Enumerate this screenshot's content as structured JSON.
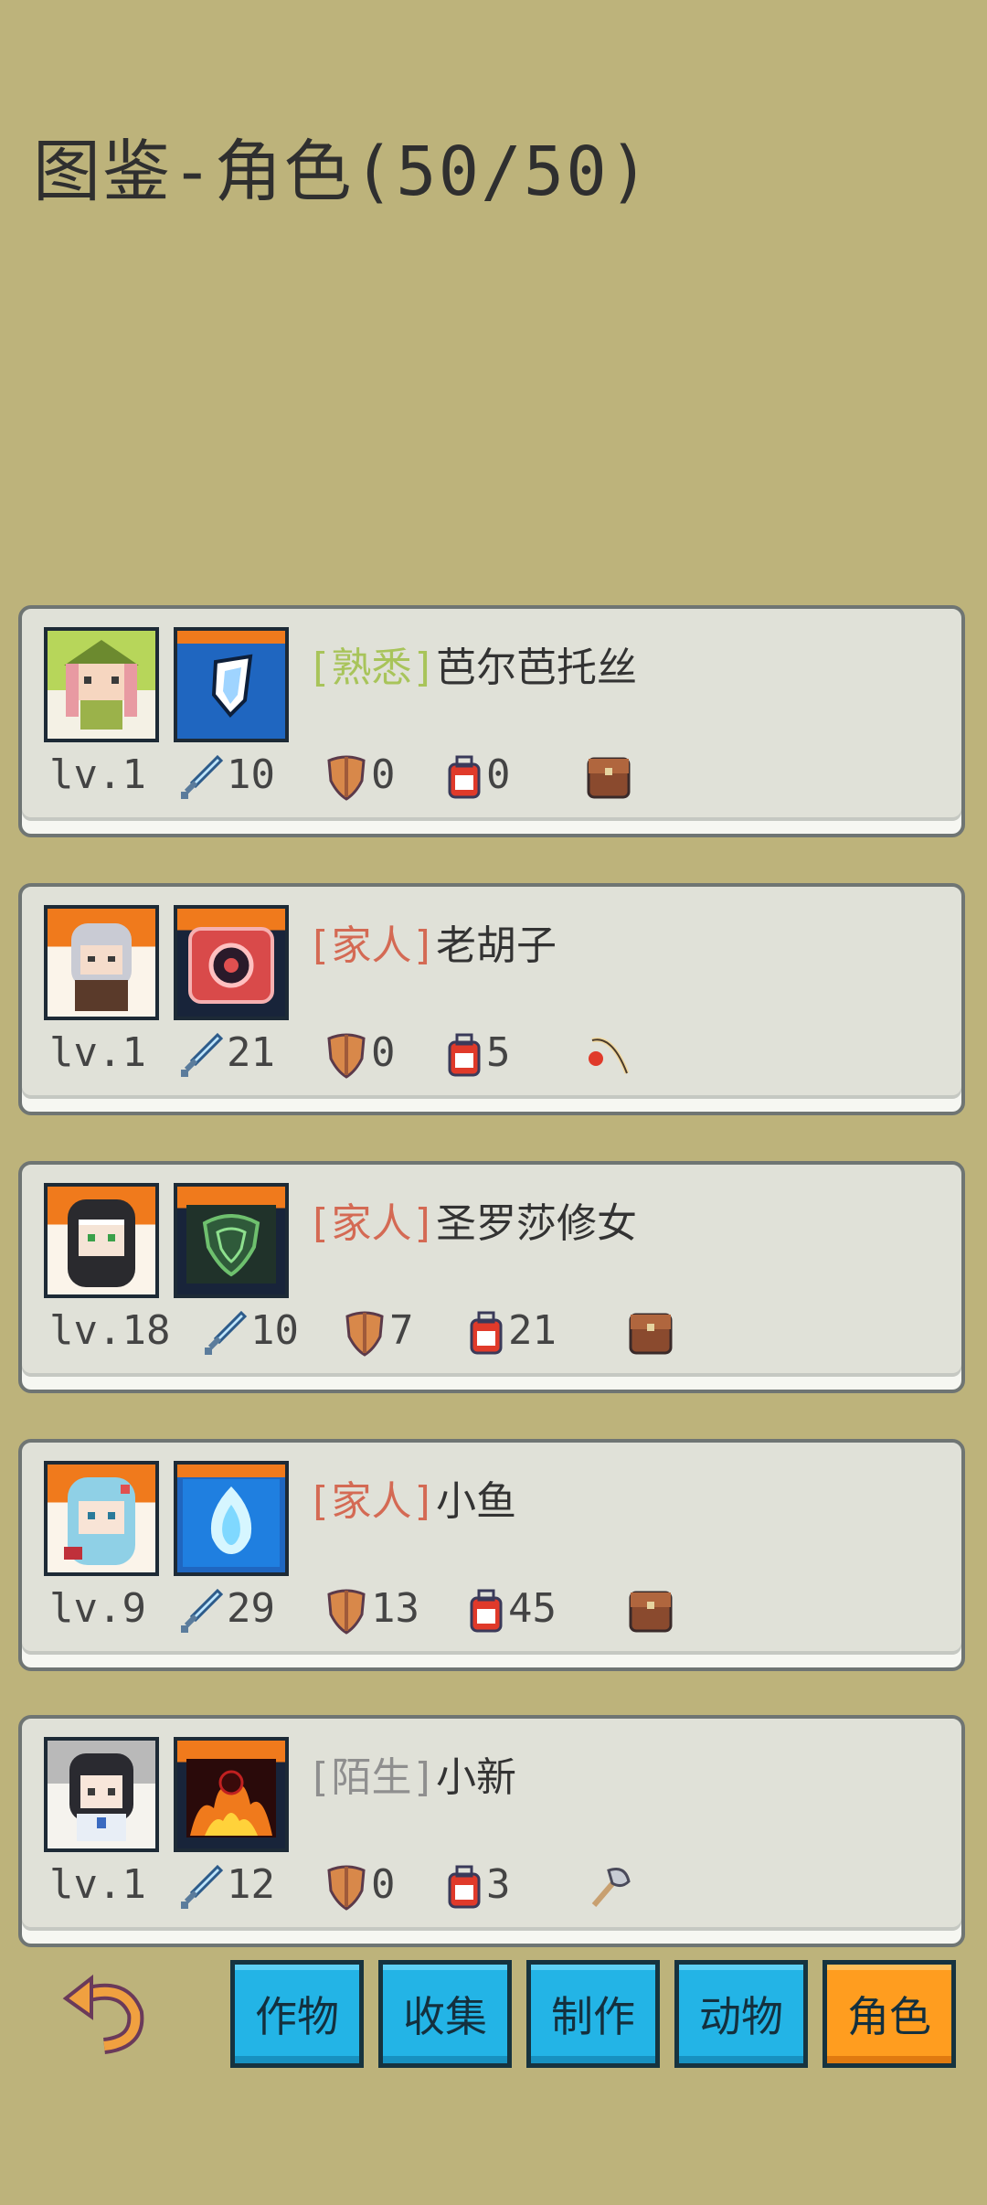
{
  "page": {
    "title": "图鉴-角色(50/50)"
  },
  "characters": [
    {
      "relation": "[熟悉]",
      "relation_color": "#a8c45a",
      "name": "芭尔芭托丝",
      "level": "lv.1",
      "attack": "10",
      "defense": "0",
      "backpack": "0",
      "tool_icon": "backpack-icon",
      "portrait_frame": "green"
    },
    {
      "relation": "[家人]",
      "relation_color": "#d46a54",
      "name": "老胡子",
      "level": "lv.1",
      "attack": "21",
      "defense": "0",
      "backpack": "5",
      "tool_icon": "fishing-rod-icon",
      "portrait_frame": "orange"
    },
    {
      "relation": "[家人]",
      "relation_color": "#d46a54",
      "name": "圣罗莎修女",
      "level": "lv.18",
      "attack": "10",
      "defense": "7",
      "backpack": "21",
      "tool_icon": "backpack-icon",
      "portrait_frame": "orange"
    },
    {
      "relation": "[家人]",
      "relation_color": "#d46a54",
      "name": "小鱼",
      "level": "lv.9",
      "attack": "29",
      "defense": "13",
      "backpack": "45",
      "tool_icon": "backpack-icon",
      "portrait_frame": "orange"
    },
    {
      "relation": "[陌生]",
      "relation_color": "#8f8f8f",
      "name": "小新",
      "level": "lv.1",
      "attack": "12",
      "defense": "0",
      "backpack": "3",
      "tool_icon": "axe-icon",
      "portrait_frame": "gray"
    }
  ],
  "tabs": [
    {
      "label": "作物",
      "active": false
    },
    {
      "label": "收集",
      "active": false
    },
    {
      "label": "制作",
      "active": false
    },
    {
      "label": "动物",
      "active": false
    },
    {
      "label": "角色",
      "active": true
    }
  ]
}
